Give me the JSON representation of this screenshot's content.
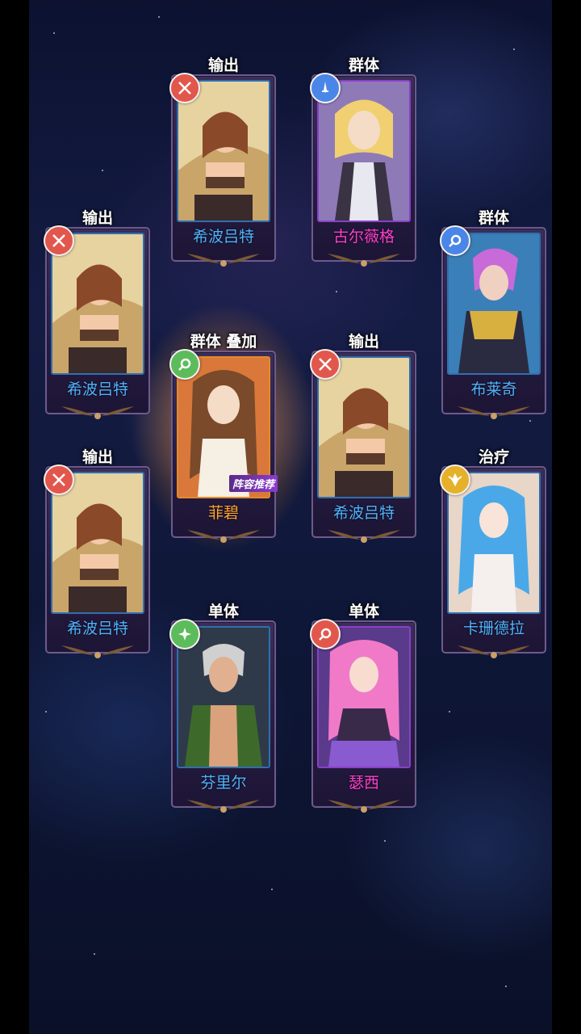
{
  "cards": [
    {
      "role": "输出",
      "name": "希波吕特",
      "badge": "crossed-arrows-icon",
      "name_color": "blue"
    },
    {
      "role": "群体",
      "name": "古尔薇格",
      "badge": "sword-icon",
      "name_color": "purple"
    },
    {
      "role": "输出",
      "name": "希波吕特",
      "badge": "crossed-arrows-icon",
      "name_color": "blue"
    },
    {
      "role": "群体",
      "name": "布莱奇",
      "badge": "magnifier-icon",
      "name_color": "blue"
    },
    {
      "role": "群体 叠加",
      "name": "菲碧",
      "badge": "magnifier-icon",
      "name_color": "gold",
      "recommend": "阵容推荐"
    },
    {
      "role": "输出",
      "name": "希波吕特",
      "badge": "crossed-arrows-icon",
      "name_color": "blue"
    },
    {
      "role": "输出",
      "name": "希波吕特",
      "badge": "crossed-arrows-icon",
      "name_color": "blue"
    },
    {
      "role": "治疗",
      "name": "卡珊德拉",
      "badge": "wing-emblem-icon",
      "name_color": "blue"
    },
    {
      "role": "单体",
      "name": "芬里尔",
      "badge": "shuriken-icon",
      "name_color": "blue"
    },
    {
      "role": "单体",
      "name": "瑟西",
      "badge": "magnifier-icon",
      "name_color": "purple"
    }
  ],
  "colors": {
    "name_blue": "#4fb3ff",
    "name_purple": "#ff3fd0",
    "name_gold": "#ffa531",
    "role_text": "#ffffff"
  }
}
